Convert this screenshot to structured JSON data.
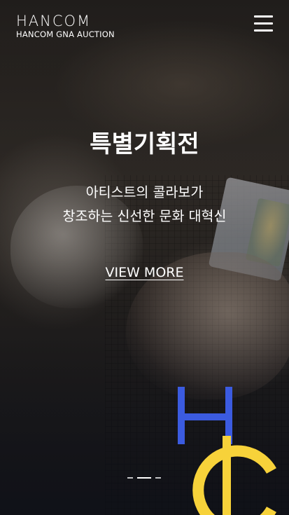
{
  "header": {
    "logo_word": "HANCOM",
    "logo_subtitle": "HANCOM GNA AUCTION",
    "menu_icon": "hamburger-menu-icon"
  },
  "hero": {
    "title": "특별기획전",
    "subtitle_lines": [
      "아티스트의 콜라보가",
      "창조하는 신선한 문화 대혁신"
    ],
    "cta_label": "VIEW MORE"
  },
  "carousel": {
    "slide_count": 3,
    "active_index": 1
  },
  "brand_mark": {
    "letters": "HC",
    "h_color": "#3b5be0",
    "c_color": "#f7d23a"
  }
}
